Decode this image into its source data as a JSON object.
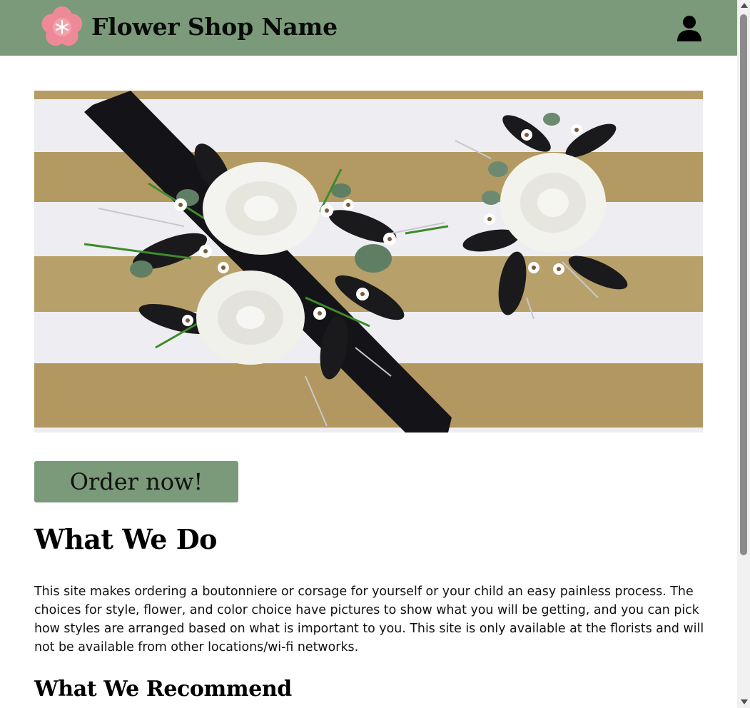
{
  "header": {
    "shop_name": "Flower Shop Name",
    "logo_icon": "pink-flower-logo",
    "account_icon": "user-icon",
    "bg_color": "#7a9a79"
  },
  "hero": {
    "image": "corsage-and-boutonniere-photo"
  },
  "main": {
    "order_button_label": "Order now!",
    "what_we_do_heading": "What We Do",
    "what_we_do_text": "This site makes ordering a boutonniere or corsage for yourself or your child an easy painless process. The choices for style, flower, and color choice have pictures to show what you will be getting, and you can pick how styles are arranged based on what is important to you. This site is only available at the florists and will not be available from other locations/wi-fi networks.",
    "recommend_heading": "What We Recommend"
  },
  "colors": {
    "accent": "#7a9a79",
    "logo_pink": "#ee8a97"
  }
}
